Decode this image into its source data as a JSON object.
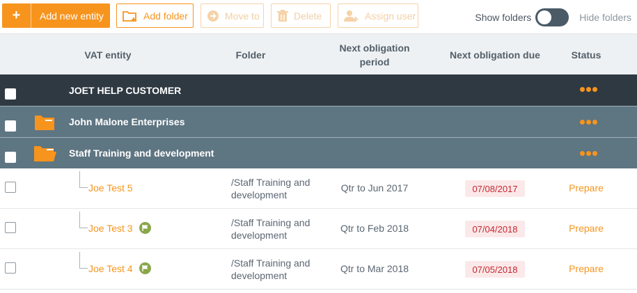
{
  "toolbar": {
    "add_entity": "Add new entity",
    "add_folder": "Add folder",
    "move_to": "Move to",
    "delete": "Delete",
    "assign_user": "Assign user",
    "show_folders": "Show folders",
    "hide_folders": "Hide folders"
  },
  "table": {
    "headers": {
      "vat_entity": "VAT entity",
      "folder": "Folder",
      "next_period": "Next obligation period",
      "next_due": "Next obligation due",
      "status": "Status"
    },
    "group_rows": [
      {
        "name": "JOET HELP CUSTOMER"
      },
      {
        "name": "John Malone Enterprises"
      },
      {
        "name": "Staff Training and development"
      }
    ],
    "child_rows": [
      {
        "name": "Joe Test 5",
        "folder": "/Staff Training and development",
        "period": "Qtr to Jun 2017",
        "due": "07/08/2017",
        "status": "Prepare"
      },
      {
        "name": "Joe Test 3",
        "folder": "/Staff Training and development",
        "period": "Qtr to Feb 2018",
        "due": "07/04/2018",
        "status": "Prepare"
      },
      {
        "name": "Joe Test 4",
        "folder": "/Staff Training and development",
        "period": "Qtr to Mar 2018",
        "due": "07/05/2018",
        "status": "Prepare"
      }
    ]
  },
  "colors": {
    "accent": "#f7941d",
    "dark_row": "#2f3942",
    "folder_row": "#5e7582",
    "due_text": "#c4262e",
    "flag": "#8aa64b"
  }
}
